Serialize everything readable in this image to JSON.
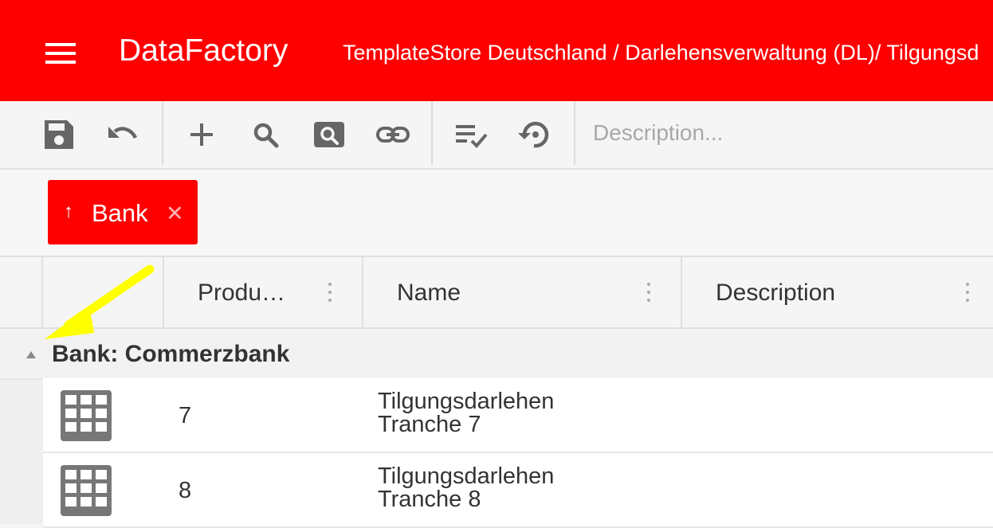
{
  "header": {
    "app_title": "DataFactory",
    "breadcrumb": "TemplateStore Deutschland / Darlehensverwaltung (DL)/ Tilgungsd",
    "background_color": "#ff0000"
  },
  "toolbar": {
    "buttons": [
      {
        "name": "save-icon"
      },
      {
        "name": "undo-icon"
      },
      {
        "name": "add-icon"
      },
      {
        "name": "search-icon"
      },
      {
        "name": "search-box-icon"
      },
      {
        "name": "link-icon"
      },
      {
        "name": "checklist-icon"
      },
      {
        "name": "restore-icon"
      }
    ],
    "description_placeholder": "Description..."
  },
  "group_chip": {
    "arrow": "↑",
    "label": "Bank",
    "close": "✕"
  },
  "columns": [
    {
      "label": "Produ…"
    },
    {
      "label": "Name"
    },
    {
      "label": "Description"
    }
  ],
  "group": {
    "title": "Bank: Commerzbank"
  },
  "rows": [
    {
      "number": "7",
      "name_line1": "Tilgungsdarlehen",
      "name_line2": "Tranche 7",
      "icon": "grid-icon"
    },
    {
      "number": "8",
      "name_line1": "Tilgungsdarlehen",
      "name_line2": "Tranche 8",
      "icon": "grid-icon"
    }
  ],
  "annotation": {
    "arrow_color": "#ffff00"
  }
}
